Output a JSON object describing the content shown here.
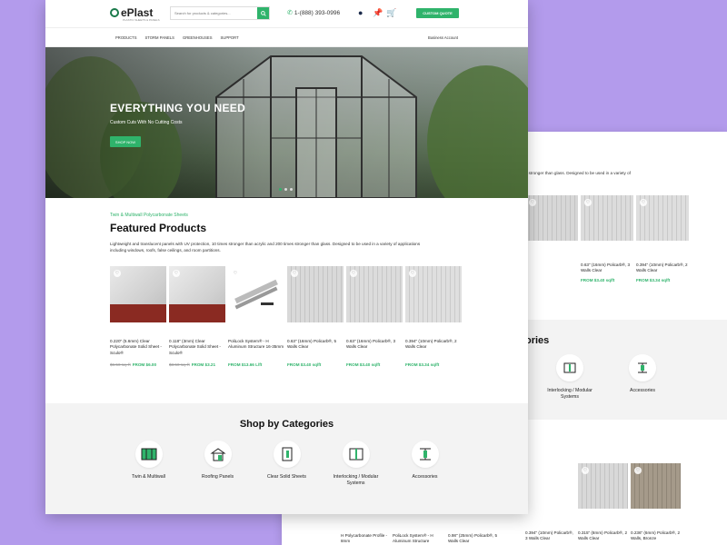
{
  "header": {
    "logo": "ePlast",
    "logo_sub": "PLASTIC SHEETS & PANELS",
    "search_placeholder": "Search for products & categories...",
    "phone": "1-(888) 393-0996",
    "custom_quote": "CUSTOM QUOTE"
  },
  "nav": {
    "items": [
      "PRODUCTS",
      "STORM PANELS",
      "GREENHOUSES",
      "SUPPORT"
    ],
    "right": "Business Account"
  },
  "hero": {
    "title": "EVERYTHING YOU NEED",
    "subtitle": "Custom Cuts With No Cutting Costs",
    "button": "SHOP NOW"
  },
  "featured": {
    "eyebrow": "Twin & Multiwall Polycarbonate Sheets",
    "title": "Featured Products",
    "description": "Lightweight and translucent panels with UV protection, 10 times stronger than acrylic and 200 times stronger than glass. Designed to be used in a variety of applications including windows, roofs, false ceilings, and room partitions.",
    "products": [
      {
        "name": "0.220\" (5.6mm) Clear Polycarbonate Solid Sheet - Sculo®",
        "old_price": "$6.50 sq. ft",
        "price": "FROM $6.00",
        "style": "film"
      },
      {
        "name": "0.118\" (3mm) Clear Polycarbonate Solid Sheet - Sculo®",
        "old_price": "$3.50 sq. ft",
        "price": "FROM $3.21",
        "style": "film"
      },
      {
        "name": "PoliLock System® - H Aluminum Structure 16-35mm",
        "old_price": "",
        "price": "FROM $13.66 L/ft",
        "style": "aluminum"
      },
      {
        "name": "0.63\" (16mm) Policarb®, 5 Walls Clear",
        "old_price": "",
        "price": "FROM $3.40 sq/ft",
        "style": "multiwall"
      },
      {
        "name": "0.63\" (16mm) Policarb®, 3 Walls Clear",
        "old_price": "",
        "price": "FROM $3.40 sq/ft",
        "style": "multiwall"
      },
      {
        "name": "0.394\" (10mm) Policarb®, 2 Walls Clear",
        "old_price": "",
        "price": "FROM $3.34 sq/ft",
        "style": "multiwall"
      }
    ]
  },
  "categories": {
    "title": "Shop by Categories",
    "items": [
      {
        "label": "Twin & Multiwall",
        "icon": "twin-multiwall-icon"
      },
      {
        "label": "Roofing Panels",
        "icon": "roofing-panels-icon"
      },
      {
        "label": "Clear Solid Sheets",
        "icon": "clear-solid-sheets-icon"
      },
      {
        "label": "Interlocking / Modular Systems",
        "icon": "interlocking-icon"
      },
      {
        "label": "Accessories",
        "icon": "accessories-icon"
      }
    ]
  },
  "back_page": {
    "desc": "s stronger than glass. Designed to be used in a variety of",
    "products": [
      {
        "name": "",
        "price": ""
      },
      {
        "name": "0.63\" (16mm) Policarb®, 3 Walls Clear",
        "price": "FROM $3.40 sq/ft"
      },
      {
        "name": "0.394\" (10mm) Policarb®, 2 Walls Clear",
        "price": "FROM $3.34 sq/ft"
      }
    ],
    "left_name": "ft",
    "left_price": "/ft",
    "cat_title": "ories",
    "cats": [
      {
        "label": "Interlocking / Modular Systems"
      },
      {
        "label": "Accessories"
      }
    ],
    "row2": [
      {
        "name": "H Polycarbonate Profile - 8mm"
      },
      {
        "name": "PoliLock System® - H Aluminum Structure"
      },
      {
        "name": "0.98\" (25mm) Policarb®, 5 Walls Clear"
      },
      {
        "name": "0.394\" (10mm) Policarb®, 3 Walls Clear"
      },
      {
        "name": "0.315\" (8mm) Policarb®, 2 Walls Clear"
      },
      {
        "name": "0.236\" (6mm) Policarb®, 2 Walls, Bronze"
      }
    ]
  },
  "colors": {
    "accent": "#2fb36b",
    "background": "#b39bec",
    "navy": "#1b2a4a"
  }
}
